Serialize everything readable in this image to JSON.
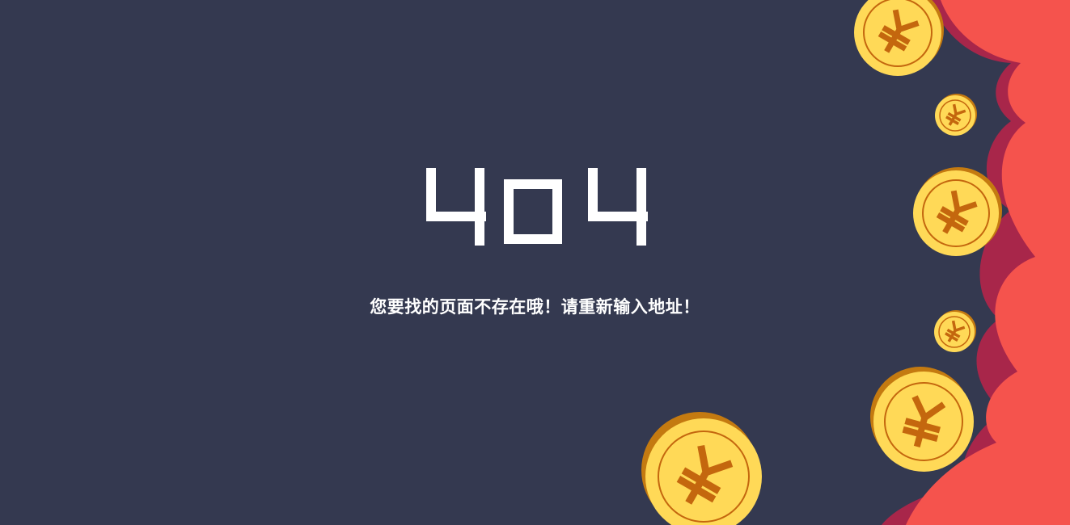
{
  "error": {
    "code": "404",
    "message": "您要找的页面不存在哦！请重新输入地址！"
  },
  "colors": {
    "background": "#343950",
    "text": "#ffffff",
    "cloud_front": "#f5534d",
    "cloud_shadow": "#a8264a",
    "coin_face": "#ffd957",
    "coin_edge": "#c47a10",
    "coin_symbol": "#c4670e"
  },
  "decor": {
    "coin_symbol": "¥",
    "icons": [
      "cloud-icon",
      "coin-icon"
    ]
  }
}
